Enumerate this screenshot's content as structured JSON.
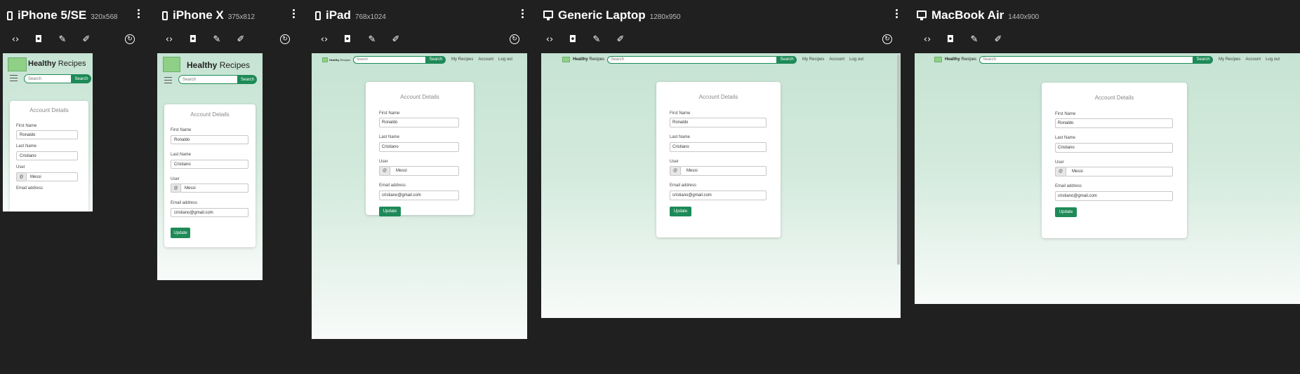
{
  "devices": [
    {
      "name": "iPhone 5/SE",
      "size": "320x568",
      "type": "phone"
    },
    {
      "name": "iPhone X",
      "size": "375x812",
      "type": "phone"
    },
    {
      "name": "iPad",
      "size": "768x1024",
      "type": "phone"
    },
    {
      "name": "Generic Laptop",
      "size": "1280x950",
      "type": "monitor"
    },
    {
      "name": "MacBook Air",
      "size": "1440x900",
      "type": "monitor"
    }
  ],
  "toolbar": {
    "code_icon": "code-icon",
    "screenshot_icon": "camera-icon",
    "color_picker_icon": "eyedropper-icon",
    "edit_icon": "edit-icon",
    "rotate_icon": "rotate-icon"
  },
  "site": {
    "brand_bold": "Healthy",
    "brand_rest": " Recipes",
    "search_placeholder": "Search",
    "search_button": "Search",
    "nav": [
      "My Recipes",
      "Account",
      "Log out"
    ]
  },
  "form": {
    "title": "Account Details",
    "first_name_label": "First Name",
    "first_name_value": "Ronaldo",
    "last_name_label": "Last Name",
    "last_name_value": "Cristiano",
    "user_label": "User",
    "user_prefix": "@",
    "user_value": "Messi",
    "email_label": "Email address",
    "email_value": "cristiano@gmail.com",
    "submit_label": "Update"
  },
  "colors": {
    "brand_green": "#1d8a57",
    "logo_green": "#8fcf86",
    "background_top": "#c6e3d3",
    "tool_background": "#202020"
  }
}
